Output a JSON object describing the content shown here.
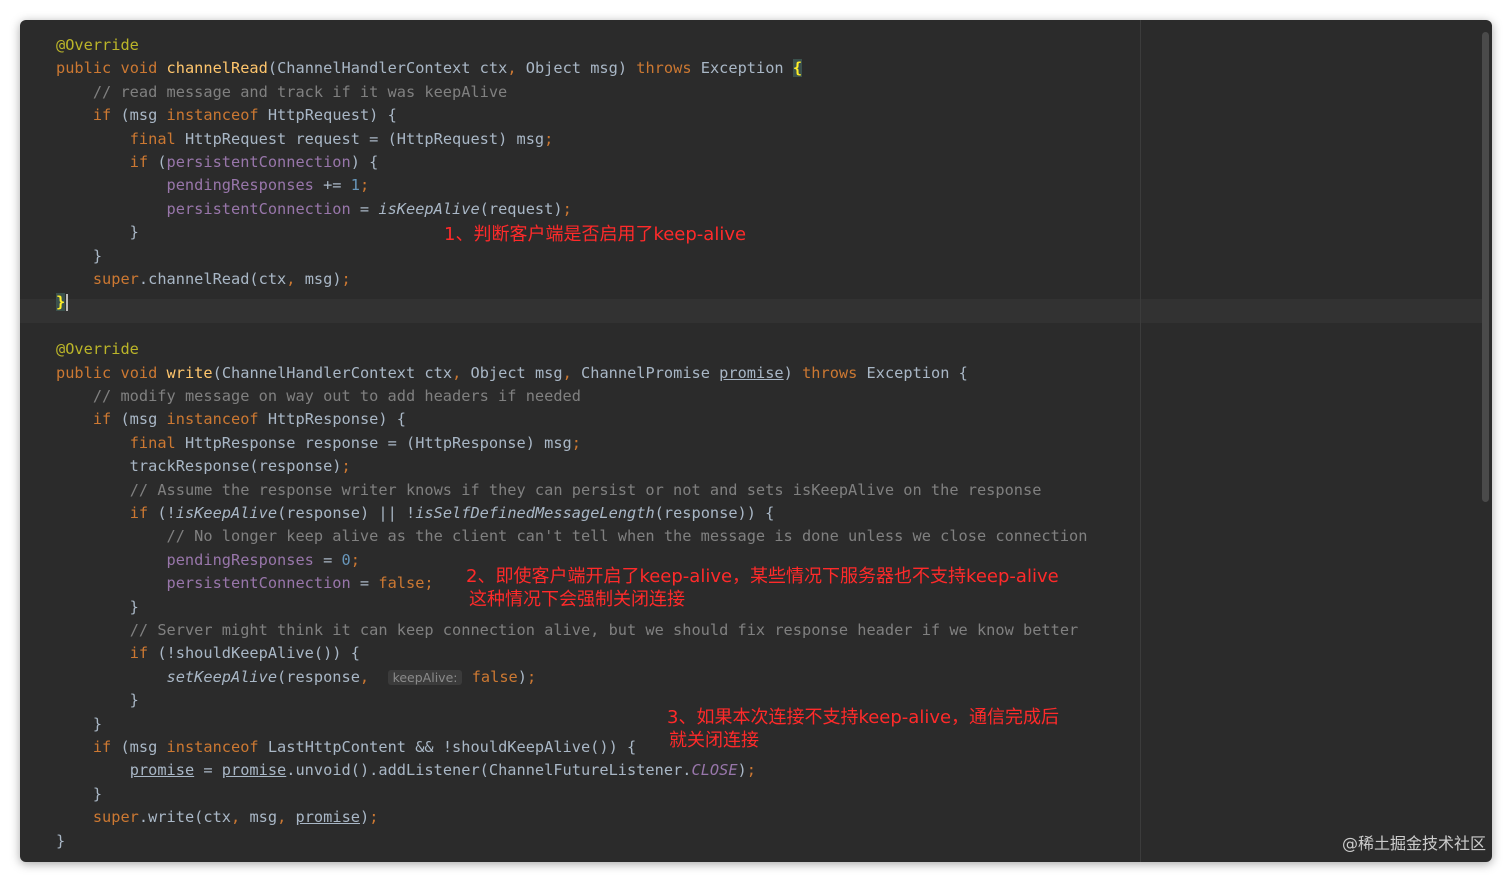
{
  "theme": {
    "background": "#2b2b2b",
    "keyword": "#cc7832",
    "annotation": "#bbb529",
    "method_decl": "#ffc66d",
    "comment": "#808080",
    "field": "#9876aa",
    "number": "#6897bb",
    "default_text": "#a9b7c6",
    "annotation_note_color": "#ff2a2a"
  },
  "editor": {
    "lines": [
      [
        {
          "t": "@Override",
          "c": "ann"
        }
      ],
      [
        {
          "t": "public",
          "c": "kw"
        },
        {
          "t": " "
        },
        {
          "t": "void",
          "c": "kw"
        },
        {
          "t": " "
        },
        {
          "t": "channelRead",
          "c": "fn"
        },
        {
          "t": "(ChannelHandlerContext ctx"
        },
        {
          "t": ",",
          "c": "kw"
        },
        {
          "t": " Object msg) "
        },
        {
          "t": "throws",
          "c": "kw"
        },
        {
          "t": " Exception "
        },
        {
          "t": "{",
          "c": "brace-match"
        }
      ],
      [
        {
          "t": "    "
        },
        {
          "t": "// read message and track if it was keepAlive",
          "c": "cm"
        }
      ],
      [
        {
          "t": "    "
        },
        {
          "t": "if",
          "c": "kw"
        },
        {
          "t": " (msg "
        },
        {
          "t": "instanceof",
          "c": "kw"
        },
        {
          "t": " HttpRequest) {"
        }
      ],
      [
        {
          "t": "        "
        },
        {
          "t": "final",
          "c": "kw"
        },
        {
          "t": " HttpRequest request = (HttpRequest) msg"
        },
        {
          "t": ";",
          "c": "kw"
        }
      ],
      [
        {
          "t": "        "
        },
        {
          "t": "if",
          "c": "kw"
        },
        {
          "t": " ("
        },
        {
          "t": "persistentConnection",
          "c": "fld"
        },
        {
          "t": ") {"
        }
      ],
      [
        {
          "t": "            "
        },
        {
          "t": "pendingResponses",
          "c": "fld"
        },
        {
          "t": " += "
        },
        {
          "t": "1",
          "c": "num"
        },
        {
          "t": ";",
          "c": "kw"
        }
      ],
      [
        {
          "t": "            "
        },
        {
          "t": "persistentConnection",
          "c": "fld"
        },
        {
          "t": " = "
        },
        {
          "t": "isKeepAlive",
          "c": "it"
        },
        {
          "t": "(request)"
        },
        {
          "t": ";",
          "c": "kw"
        }
      ],
      [
        {
          "t": "        }"
        }
      ],
      [
        {
          "t": "    }"
        }
      ],
      [
        {
          "t": "    "
        },
        {
          "t": "super",
          "c": "kw"
        },
        {
          "t": ".channelRead(ctx"
        },
        {
          "t": ",",
          "c": "kw"
        },
        {
          "t": " msg)"
        },
        {
          "t": ";",
          "c": "kw"
        }
      ],
      [
        {
          "t": "}",
          "c": "brace-match"
        },
        {
          "t": "",
          "c": "caret"
        }
      ],
      [],
      [
        {
          "t": "@Override",
          "c": "ann"
        }
      ],
      [
        {
          "t": "public",
          "c": "kw"
        },
        {
          "t": " "
        },
        {
          "t": "void",
          "c": "kw"
        },
        {
          "t": " "
        },
        {
          "t": "write",
          "c": "fn"
        },
        {
          "t": "(ChannelHandlerContext ctx"
        },
        {
          "t": ",",
          "c": "kw"
        },
        {
          "t": " Object msg"
        },
        {
          "t": ",",
          "c": "kw"
        },
        {
          "t": " ChannelPromise "
        },
        {
          "t": "promise",
          "c": "ul"
        },
        {
          "t": ") "
        },
        {
          "t": "throws",
          "c": "kw"
        },
        {
          "t": " Exception {"
        }
      ],
      [
        {
          "t": "    "
        },
        {
          "t": "// modify message on way out to add headers if needed",
          "c": "cm"
        }
      ],
      [
        {
          "t": "    "
        },
        {
          "t": "if",
          "c": "kw"
        },
        {
          "t": " (msg "
        },
        {
          "t": "instanceof",
          "c": "kw"
        },
        {
          "t": " HttpResponse) {"
        }
      ],
      [
        {
          "t": "        "
        },
        {
          "t": "final",
          "c": "kw"
        },
        {
          "t": " HttpResponse response = (HttpResponse) msg"
        },
        {
          "t": ";",
          "c": "kw"
        }
      ],
      [
        {
          "t": "        trackResponse(response)"
        },
        {
          "t": ";",
          "c": "kw"
        }
      ],
      [
        {
          "t": "        "
        },
        {
          "t": "// Assume the response writer knows if they can persist or not and sets isKeepAlive on the response",
          "c": "cm"
        }
      ],
      [
        {
          "t": "        "
        },
        {
          "t": "if",
          "c": "kw"
        },
        {
          "t": " (!"
        },
        {
          "t": "isKeepAlive",
          "c": "it"
        },
        {
          "t": "(response) || !"
        },
        {
          "t": "isSelfDefinedMessageLength",
          "c": "it"
        },
        {
          "t": "(response)) {"
        }
      ],
      [
        {
          "t": "            "
        },
        {
          "t": "// No longer keep alive as the client can't tell when the message is done unless we close connection",
          "c": "cm"
        }
      ],
      [
        {
          "t": "            "
        },
        {
          "t": "pendingResponses",
          "c": "fld"
        },
        {
          "t": " = "
        },
        {
          "t": "0",
          "c": "num"
        },
        {
          "t": ";",
          "c": "kw"
        }
      ],
      [
        {
          "t": "            "
        },
        {
          "t": "persistentConnection",
          "c": "fld"
        },
        {
          "t": " = "
        },
        {
          "t": "false",
          "c": "kw"
        },
        {
          "t": ";",
          "c": "kw"
        }
      ],
      [
        {
          "t": "        }"
        }
      ],
      [
        {
          "t": "        "
        },
        {
          "t": "// Server might think it can keep connection alive, but we should fix response header if we know better",
          "c": "cm"
        }
      ],
      [
        {
          "t": "        "
        },
        {
          "t": "if",
          "c": "kw"
        },
        {
          "t": " (!shouldKeepAlive()) {"
        }
      ],
      [
        {
          "t": "            "
        },
        {
          "t": "setKeepAlive",
          "c": "it"
        },
        {
          "t": "(response"
        },
        {
          "t": ",",
          "c": "kw"
        },
        {
          "t": "  "
        },
        {
          "t": "keepAlive:",
          "c": "hint"
        },
        {
          "t": " "
        },
        {
          "t": "false",
          "c": "kw"
        },
        {
          "t": ")"
        },
        {
          "t": ";",
          "c": "kw"
        }
      ],
      [
        {
          "t": "        }"
        }
      ],
      [
        {
          "t": "    }"
        }
      ],
      [
        {
          "t": "    "
        },
        {
          "t": "if",
          "c": "kw"
        },
        {
          "t": " (msg "
        },
        {
          "t": "instanceof",
          "c": "kw"
        },
        {
          "t": " LastHttpContent && !shouldKeepAlive()) {"
        }
      ],
      [
        {
          "t": "        "
        },
        {
          "t": "promise",
          "c": "ul"
        },
        {
          "t": " = "
        },
        {
          "t": "promise",
          "c": "ul"
        },
        {
          "t": ".unvoid().addListener(ChannelFutureListener."
        },
        {
          "t": "CLOSE",
          "c": "fld-it"
        },
        {
          "t": ")"
        },
        {
          "t": ";",
          "c": "kw"
        }
      ],
      [
        {
          "t": "    }"
        }
      ],
      [
        {
          "t": "    "
        },
        {
          "t": "super",
          "c": "kw"
        },
        {
          "t": ".write(ctx"
        },
        {
          "t": ",",
          "c": "kw"
        },
        {
          "t": " msg"
        },
        {
          "t": ",",
          "c": "kw"
        },
        {
          "t": " "
        },
        {
          "t": "promise",
          "c": "ul"
        },
        {
          "t": ")"
        },
        {
          "t": ";",
          "c": "kw"
        }
      ],
      [
        {
          "t": "}"
        }
      ]
    ]
  },
  "annotations": {
    "note1": "1、判断客户端是否启用了keep-alive",
    "note2_line1": "2、即使客户端开启了keep-alive，某些情况下服务器也不支持keep-alive",
    "note2_line2": "这种情况下会强制关闭连接",
    "note3_line1": "3、如果本次连接不支持keep-alive，通信完成后",
    "note3_line2": "就关闭连接"
  },
  "watermark": "@稀土掘金技术社区"
}
